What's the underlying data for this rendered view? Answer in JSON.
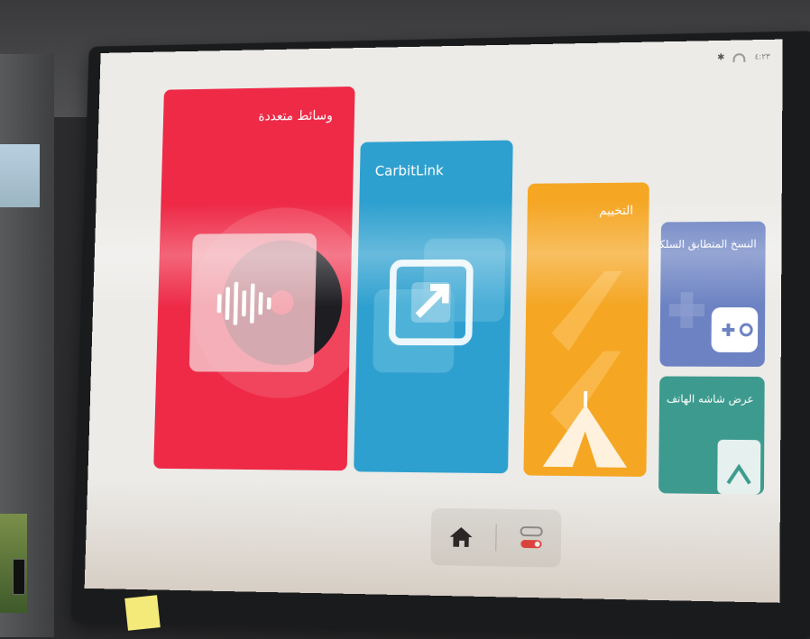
{
  "status": {
    "time": "٤:٢٣"
  },
  "tiles": {
    "media": {
      "label": "وسائط متعددة",
      "color": "#ee2a47"
    },
    "carbitlink": {
      "label": "CarbitLink",
      "color": "#2ea0cf"
    },
    "camping": {
      "label": "التخييم",
      "color": "#f5a623"
    },
    "mirroring": {
      "label": "النسخ المتطابق السلكي",
      "color": "#6c82c2"
    },
    "phone_display": {
      "label": "عرض شاشه الهاتف",
      "color": "#3d9a8e"
    }
  },
  "dock": {
    "home": {
      "icon": "home-icon"
    },
    "toggle": {
      "icon": "toggle-icon"
    }
  },
  "icons": {
    "media": "music-disc-icon",
    "carbitlink": "link-squares-icon",
    "camping": "tent-icon",
    "mirroring": "gamepad-icon",
    "phone_display": "phone-cast-icon"
  }
}
